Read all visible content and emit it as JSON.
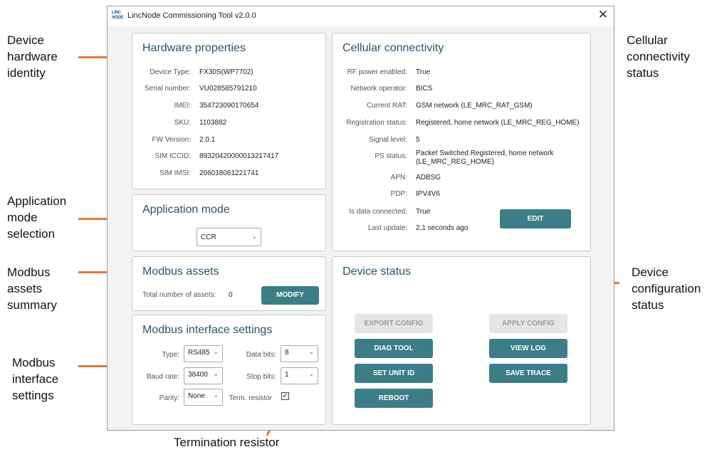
{
  "window": {
    "title": "LincNode Commissioning Tool v2.0.0",
    "icon_text": "LINC\nNODE"
  },
  "annotations": {
    "hardware": "Device\nhardware\nidentity",
    "cellular": "Cellular\nconnectivity\nstatus",
    "app_mode": "Application\nmode\nselection",
    "modbus_assets": "Modbus\nassets\nsummary",
    "device_status": "Device\nconfiguration\nstatus",
    "modbus_interface": "Modbus\ninterface\nsettings",
    "termination": "Termination resistor"
  },
  "hardware": {
    "title": "Hardware properties",
    "rows": [
      {
        "label": "Device Type:",
        "value": "FX30S(WP7702)"
      },
      {
        "label": "Serial number:",
        "value": "VU028585791210"
      },
      {
        "label": "IMEI:",
        "value": "354723090170654"
      },
      {
        "label": "SKU:",
        "value": "1103882"
      },
      {
        "label": "FW Version:",
        "value": "2.0.1"
      },
      {
        "label": "SIM ICCID:",
        "value": "89320420000013217417"
      },
      {
        "label": "SIM IMSI:",
        "value": "206018061221741"
      }
    ]
  },
  "app_mode": {
    "title": "Application mode",
    "value": "CCR"
  },
  "modbus_assets": {
    "title": "Modbus assets",
    "count_label": "Total number of assets:",
    "count": "0",
    "modify_label": "MODIFY"
  },
  "modbus_interface": {
    "title": "Modbus interface settings",
    "type_label": "Type:",
    "type_value": "RS485",
    "baud_label": "Baud rate:",
    "baud_value": "38400",
    "parity_label": "Parity:",
    "parity_value": "None",
    "databits_label": "Data bits:",
    "databits_value": "8",
    "stopbits_label": "Stop bits:",
    "stopbits_value": "1",
    "term_label": "Term. resistor",
    "term_checked": true
  },
  "cellular": {
    "title": "Cellular connectivity",
    "rows": [
      {
        "label": "RF power enabled:",
        "value": "True"
      },
      {
        "label": "Network operator:",
        "value": "BICS"
      },
      {
        "label": "Current RAT:",
        "value": "GSM network (LE_MRC_RAT_GSM)"
      },
      {
        "label": "Registration status:",
        "value": "Registered, home network (LE_MRC_REG_HOME)"
      },
      {
        "label": "Signal level:",
        "value": "5"
      },
      {
        "label": "PS status:",
        "value": "Packet Switched Registered, home network\n(LE_MRC_REG_HOME)"
      },
      {
        "label": "APN:",
        "value": "ADBSG"
      },
      {
        "label": "PDP:",
        "value": "IPV4V6"
      },
      {
        "label": "Is data connected:",
        "value": "True"
      },
      {
        "label": "Last update:",
        "value": "2,1 seconds ago"
      }
    ],
    "edit_label": "EDIT"
  },
  "device_status": {
    "title": "Device status",
    "export_label": "EXPORT CONFIG",
    "apply_label": "APPLY CONFIG",
    "diag_label": "DIAG TOOL",
    "viewlog_label": "VIEW LOG",
    "setunit_label": "SET UNIT ID",
    "savetrace_label": "SAVE TRACE",
    "reboot_label": "REBOOT"
  },
  "colors": {
    "accent": "#3b7e87",
    "arrow": "#e07a3c",
    "title": "#2a5468"
  }
}
